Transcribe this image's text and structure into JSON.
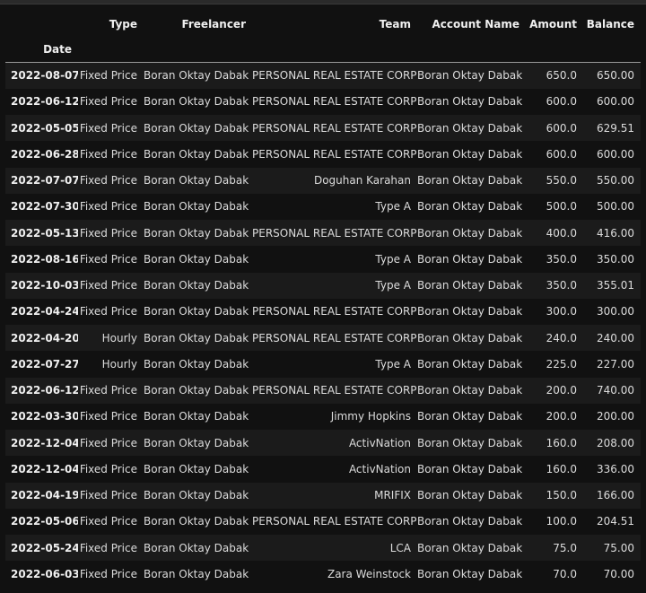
{
  "table": {
    "columns": [
      "Type",
      "Freelancer",
      "Team",
      "Account Name",
      "Amount",
      "Balance"
    ],
    "index_name": "Date",
    "rows": [
      {
        "date": "2022-08-07",
        "type": "Fixed Price",
        "freelancer": "Boran Oktay Dabak",
        "team": "PERSONAL REAL ESTATE CORP",
        "account": "Boran Oktay Dabak",
        "amount": "650.0",
        "balance": "650.00"
      },
      {
        "date": "2022-06-12",
        "type": "Fixed Price",
        "freelancer": "Boran Oktay Dabak",
        "team": "PERSONAL REAL ESTATE CORP",
        "account": "Boran Oktay Dabak",
        "amount": "600.0",
        "balance": "600.00"
      },
      {
        "date": "2022-05-05",
        "type": "Fixed Price",
        "freelancer": "Boran Oktay Dabak",
        "team": "PERSONAL REAL ESTATE CORP",
        "account": "Boran Oktay Dabak",
        "amount": "600.0",
        "balance": "629.51"
      },
      {
        "date": "2022-06-28",
        "type": "Fixed Price",
        "freelancer": "Boran Oktay Dabak",
        "team": "PERSONAL REAL ESTATE CORP",
        "account": "Boran Oktay Dabak",
        "amount": "600.0",
        "balance": "600.00"
      },
      {
        "date": "2022-07-07",
        "type": "Fixed Price",
        "freelancer": "Boran Oktay Dabak",
        "team": "Doguhan Karahan",
        "account": "Boran Oktay Dabak",
        "amount": "550.0",
        "balance": "550.00"
      },
      {
        "date": "2022-07-30",
        "type": "Fixed Price",
        "freelancer": "Boran Oktay Dabak",
        "team": "Type A",
        "account": "Boran Oktay Dabak",
        "amount": "500.0",
        "balance": "500.00"
      },
      {
        "date": "2022-05-13",
        "type": "Fixed Price",
        "freelancer": "Boran Oktay Dabak",
        "team": "PERSONAL REAL ESTATE CORP",
        "account": "Boran Oktay Dabak",
        "amount": "400.0",
        "balance": "416.00"
      },
      {
        "date": "2022-08-16",
        "type": "Fixed Price",
        "freelancer": "Boran Oktay Dabak",
        "team": "Type A",
        "account": "Boran Oktay Dabak",
        "amount": "350.0",
        "balance": "350.00"
      },
      {
        "date": "2022-10-03",
        "type": "Fixed Price",
        "freelancer": "Boran Oktay Dabak",
        "team": "Type A",
        "account": "Boran Oktay Dabak",
        "amount": "350.0",
        "balance": "355.01"
      },
      {
        "date": "2022-04-24",
        "type": "Fixed Price",
        "freelancer": "Boran Oktay Dabak",
        "team": "PERSONAL REAL ESTATE CORP",
        "account": "Boran Oktay Dabak",
        "amount": "300.0",
        "balance": "300.00"
      },
      {
        "date": "2022-04-20",
        "type": "Hourly",
        "freelancer": "Boran Oktay Dabak",
        "team": "PERSONAL REAL ESTATE CORP",
        "account": "Boran Oktay Dabak",
        "amount": "240.0",
        "balance": "240.00"
      },
      {
        "date": "2022-07-27",
        "type": "Hourly",
        "freelancer": "Boran Oktay Dabak",
        "team": "Type A",
        "account": "Boran Oktay Dabak",
        "amount": "225.0",
        "balance": "227.00"
      },
      {
        "date": "2022-06-12",
        "type": "Fixed Price",
        "freelancer": "Boran Oktay Dabak",
        "team": "PERSONAL REAL ESTATE CORP",
        "account": "Boran Oktay Dabak",
        "amount": "200.0",
        "balance": "740.00"
      },
      {
        "date": "2022-03-30",
        "type": "Fixed Price",
        "freelancer": "Boran Oktay Dabak",
        "team": "Jimmy Hopkins",
        "account": "Boran Oktay Dabak",
        "amount": "200.0",
        "balance": "200.00"
      },
      {
        "date": "2022-12-04",
        "type": "Fixed Price",
        "freelancer": "Boran Oktay Dabak",
        "team": "ActivNation",
        "account": "Boran Oktay Dabak",
        "amount": "160.0",
        "balance": "208.00"
      },
      {
        "date": "2022-12-04",
        "type": "Fixed Price",
        "freelancer": "Boran Oktay Dabak",
        "team": "ActivNation",
        "account": "Boran Oktay Dabak",
        "amount": "160.0",
        "balance": "336.00"
      },
      {
        "date": "2022-04-19",
        "type": "Fixed Price",
        "freelancer": "Boran Oktay Dabak",
        "team": "MRIFIX",
        "account": "Boran Oktay Dabak",
        "amount": "150.0",
        "balance": "166.00"
      },
      {
        "date": "2022-05-06",
        "type": "Fixed Price",
        "freelancer": "Boran Oktay Dabak",
        "team": "PERSONAL REAL ESTATE CORP",
        "account": "Boran Oktay Dabak",
        "amount": "100.0",
        "balance": "204.51"
      },
      {
        "date": "2022-05-24",
        "type": "Fixed Price",
        "freelancer": "Boran Oktay Dabak",
        "team": "LCA",
        "account": "Boran Oktay Dabak",
        "amount": "75.0",
        "balance": "75.00"
      },
      {
        "date": "2022-06-03",
        "type": "Fixed Price",
        "freelancer": "Boran Oktay Dabak",
        "team": "Zara Weinstock",
        "account": "Boran Oktay Dabak",
        "amount": "70.0",
        "balance": "70.00"
      }
    ]
  },
  "colors": {
    "background": "#111111",
    "row_alt": "#1b1b1b",
    "text": "#dcdcdc",
    "header_text": "#f0f0f0",
    "rule": "#9a9a9a"
  }
}
